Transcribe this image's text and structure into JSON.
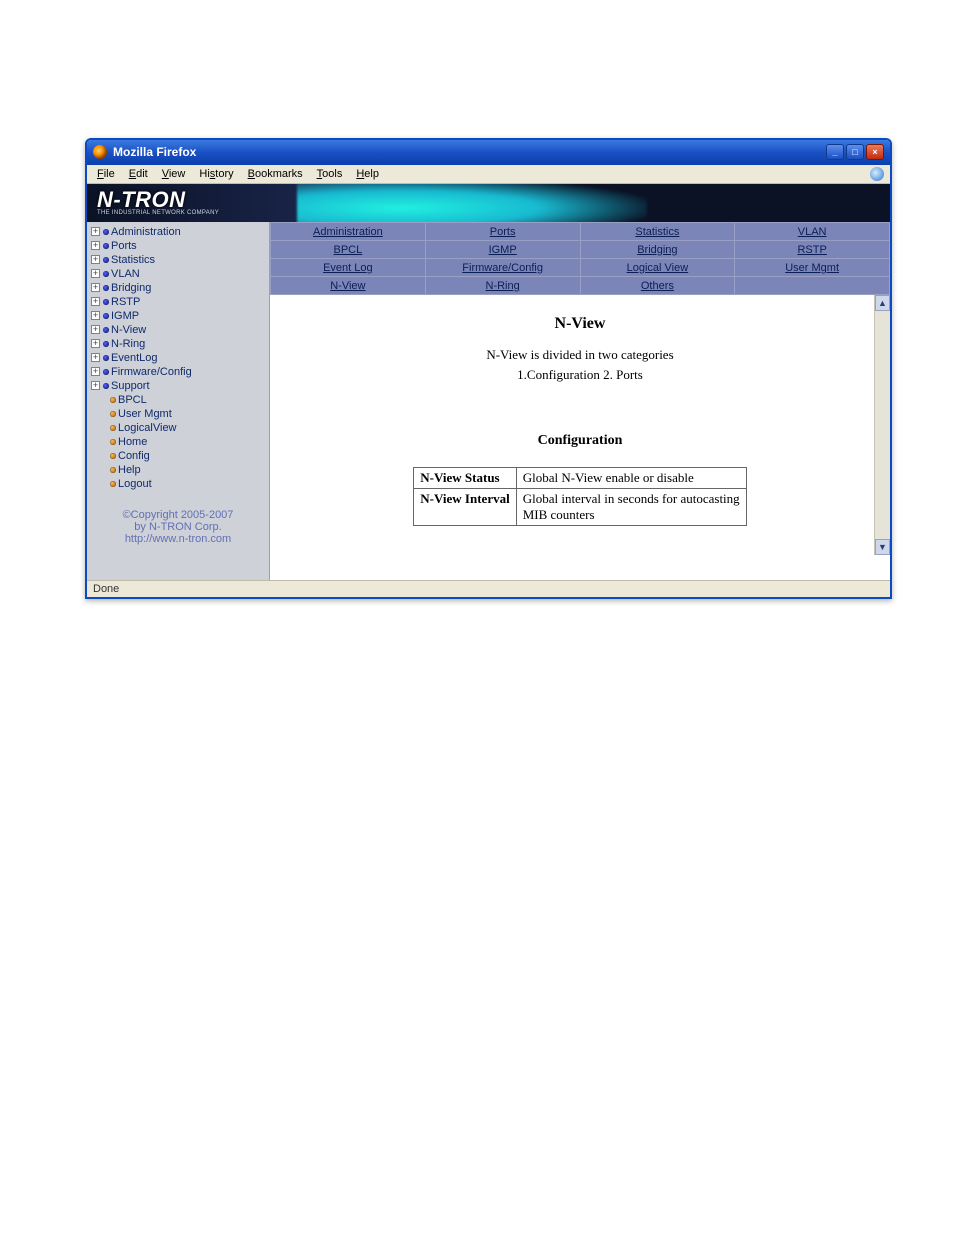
{
  "window": {
    "title": "Mozilla Firefox"
  },
  "menubar": {
    "items": [
      "File",
      "Edit",
      "View",
      "History",
      "Bookmarks",
      "Tools",
      "Help"
    ]
  },
  "logo": {
    "main": "N-TRON",
    "tag": "THE INDUSTRIAL NETWORK COMPANY"
  },
  "tree": {
    "main": [
      "Administration",
      "Ports",
      "Statistics",
      "VLAN",
      "Bridging",
      "RSTP",
      "IGMP",
      "N-View",
      "N-Ring",
      "EventLog",
      "Firmware/Config",
      "Support"
    ],
    "sub": [
      "BPCL",
      "User Mgmt",
      "LogicalView",
      "Home",
      "Config",
      "Help",
      "Logout"
    ]
  },
  "copyright": {
    "l1": "©Copyright 2005-2007",
    "l2": "by N-TRON Corp.",
    "l3": "http://www.n-tron.com"
  },
  "nav": {
    "r0": [
      "Administration",
      "Ports",
      "Statistics",
      "VLAN"
    ],
    "r1": [
      "BPCL",
      "IGMP",
      "Bridging",
      "RSTP"
    ],
    "r2": [
      "Event Log",
      "Firmware/Config",
      "Logical View",
      "User Mgmt"
    ],
    "r3": [
      "N-View",
      "N-Ring",
      "Others",
      ""
    ]
  },
  "content": {
    "heading": "N-View",
    "sub1": "N-View is divided in two categories",
    "sub2": "1.Configuration   2. Ports",
    "configHeading": "Configuration",
    "rows": [
      {
        "k": "N-View Status",
        "v": "Global N-View enable or disable"
      },
      {
        "k": "N-View Interval",
        "v": "Global interval in seconds for autocasting MIB counters"
      }
    ]
  },
  "status": {
    "text": "Done"
  }
}
